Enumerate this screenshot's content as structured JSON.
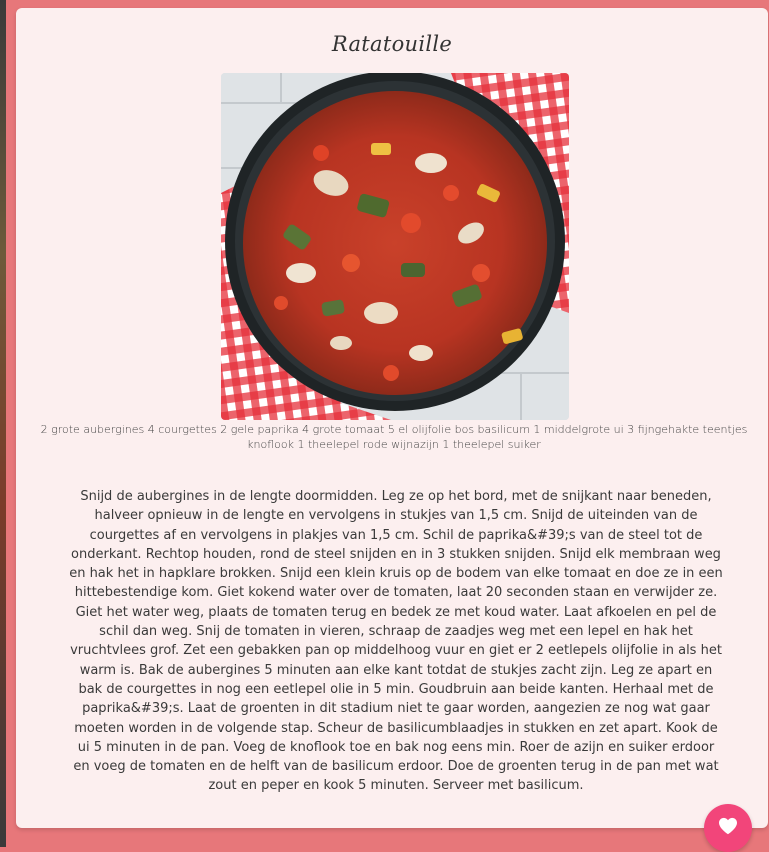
{
  "recipe": {
    "title": "Ratatouille",
    "image_alt": "Ratatouille in a pan on a red checkered cloth",
    "ingredients": "2 grote aubergines 4 courgettes 2 gele paprika 4 grote tomaat 5 el olijfolie bos basilicum 1 middelgrote ui 3 fijngehakte teentjes knoflook 1 theelepel rode wijnazijn 1 theelepel suiker",
    "instructions": "Snijd de aubergines in de lengte doormidden. Leg ze op het bord, met de snijkant naar beneden, halveer opnieuw in de lengte en vervolgens in stukjes van 1,5 cm. Snijd de uiteinden van de courgettes af en vervolgens in plakjes van 1,5 cm. Schil de paprika&#39;s van de steel tot de onderkant. Rechtop houden, rond de steel snijden en in 3 stukken snijden. Snijd elk membraan weg en hak het in hapklare brokken. Snijd een klein kruis op de bodem van elke tomaat en doe ze in een hittebestendige kom. Giet kokend water over de tomaten, laat 20 seconden staan en verwijder ze. Giet het water weg, plaats de tomaten terug en bedek ze met koud water. Laat afkoelen en pel de schil dan weg. Snij de tomaten in vieren, schraap de zaadjes weg met een lepel en hak het vruchtvlees grof. Zet een gebakken pan op middelhoog vuur en giet er 2 eetlepels olijfolie in als het warm is. Bak de aubergines 5 minuten aan elke kant totdat de stukjes zacht zijn. Leg ze apart en bak de courgettes in nog een eetlepel olie in 5 min. Goudbruin aan beide kanten. Herhaal met de paprika&#39;s. Laat de groenten in dit stadium niet te gaar worden, aangezien ze nog wat gaar moeten worden in de volgende stap. Scheur de basilicumblaadjes in stukken en zet apart. Kook de ui 5 minuten in de pan. Voeg de knoflook toe en bak nog eens min. Roer de azijn en suiker erdoor en voeg de tomaten en de helft van de basilicum erdoor. Doe de groenten terug in de pan met wat zout en peper en kook 5 minuten. Serveer met basilicum."
  },
  "actions": {
    "favorite_icon": "heart-icon"
  },
  "colors": {
    "page_background": "#e7777a",
    "card_background": "#fcefef",
    "favorite_button": "#f2457a"
  }
}
